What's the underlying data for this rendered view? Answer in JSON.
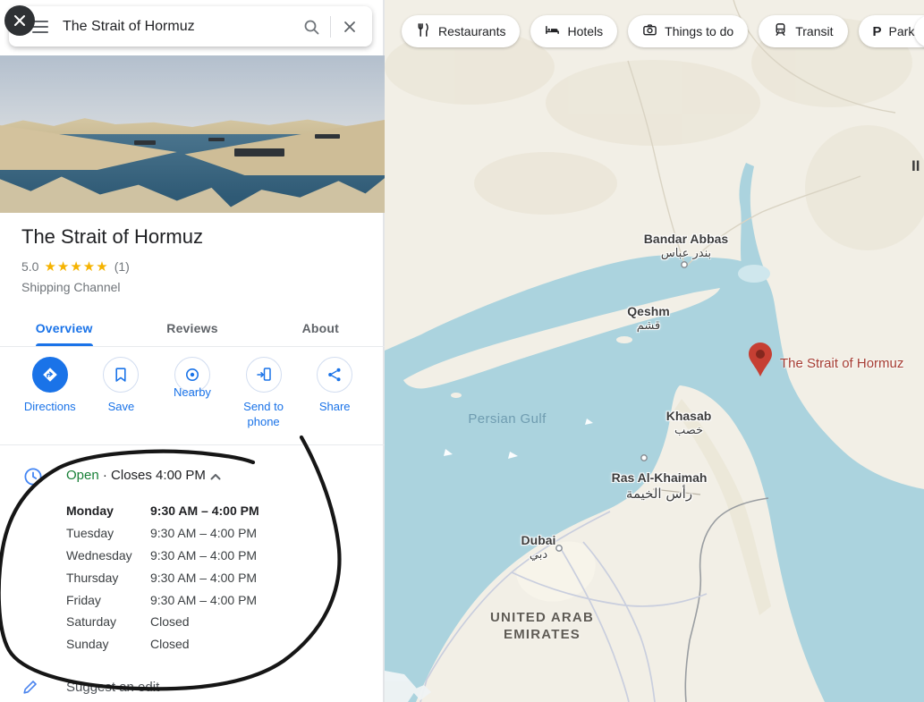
{
  "search": {
    "query": "The Strait of Hormuz"
  },
  "place": {
    "title": "The Strait of Hormuz",
    "rating_value": "5.0",
    "stars": "★★★★★",
    "review_count": "(1)",
    "category": "Shipping Channel",
    "tabs": [
      {
        "label": "Overview"
      },
      {
        "label": "Reviews"
      },
      {
        "label": "About"
      }
    ],
    "actions": [
      {
        "label": "Directions"
      },
      {
        "label": "Save"
      },
      {
        "label": "Nearby"
      },
      {
        "label": "Send to phone"
      },
      {
        "label": "Share"
      }
    ],
    "hours_summary": {
      "status": "Open",
      "detail": "· Closes 4:00 PM"
    },
    "hours": [
      {
        "day": "Monday",
        "time": "9:30 AM – 4:00 PM"
      },
      {
        "day": "Tuesday",
        "time": "9:30 AM – 4:00 PM"
      },
      {
        "day": "Wednesday",
        "time": "9:30 AM – 4:00 PM"
      },
      {
        "day": "Thursday",
        "time": "9:30 AM – 4:00 PM"
      },
      {
        "day": "Friday",
        "time": "9:30 AM – 4:00 PM"
      },
      {
        "day": "Saturday",
        "time": "Closed"
      },
      {
        "day": "Sunday",
        "time": "Closed"
      }
    ],
    "suggest_edit": "Suggest an edit"
  },
  "map": {
    "chips": [
      {
        "label": "Restaurants",
        "icon": "restaurants-icon"
      },
      {
        "label": "Hotels",
        "icon": "hotels-icon"
      },
      {
        "label": "Things to do",
        "icon": "camera-icon"
      },
      {
        "label": "Transit",
        "icon": "transit-icon"
      },
      {
        "label": "Parking",
        "icon": "parking-icon"
      }
    ],
    "labels": {
      "bandar_abbas": {
        "en": "Bandar Abbas",
        "ar": "بندر عباس"
      },
      "qeshm": {
        "en": "Qeshm",
        "ar": "قشم"
      },
      "persian_gulf": "Persian Gulf",
      "khasab": {
        "en": "Khasab",
        "ar": "خصب"
      },
      "ras_al_khaimah": {
        "en": "Ras Al-Khaimah",
        "ar": "رأس الخيمة"
      },
      "dubai": {
        "en": "Dubai",
        "ar": "دبي"
      },
      "country": {
        "line1": "UNITED ARAB",
        "line2": "EMIRATES"
      },
      "pin_label": "The Strait of Hormuz",
      "edge_partial": "II"
    },
    "colors": {
      "water": "#abd3de",
      "land": "#f2efe6",
      "accent": "#1a73e8",
      "open_green": "#188038",
      "star_gold": "#f5b301",
      "pin": "#c63f33",
      "pin_label": "#a63d33"
    }
  }
}
